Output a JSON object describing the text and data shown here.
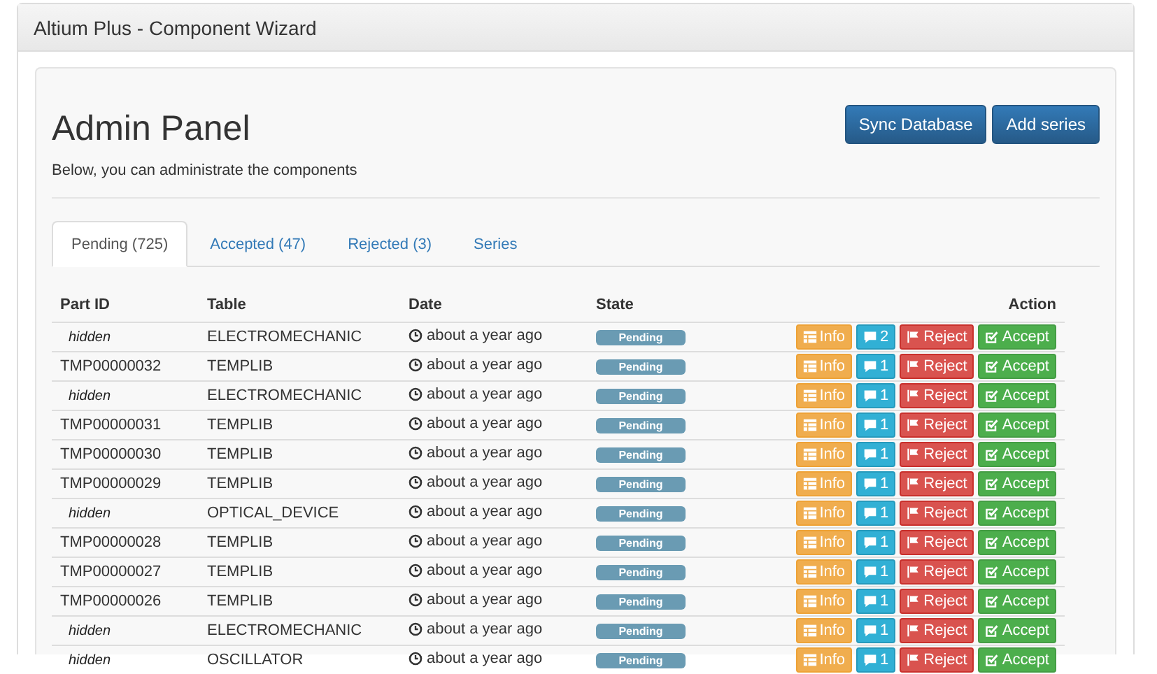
{
  "window": {
    "title": "Altium Plus - Component Wizard"
  },
  "header": {
    "title": "Admin Panel",
    "subtitle": "Below, you can administrate the components",
    "buttons": [
      "Sync Database",
      "Add series"
    ]
  },
  "tabs": [
    {
      "label": "Pending (725)",
      "selected": true
    },
    {
      "label": "Accepted (47)",
      "selected": false
    },
    {
      "label": "Rejected (3)",
      "selected": false
    },
    {
      "label": "Series",
      "selected": false
    }
  ],
  "table": {
    "columns": [
      "Part ID",
      "Table",
      "Date",
      "State",
      "Action"
    ],
    "rows": [
      {
        "part_id": "hidden",
        "hidden": true,
        "table": "ELECTROMECHANIC",
        "date": "about a year ago",
        "state": "Pending",
        "info": "Info",
        "comments": "2",
        "reject": "Reject",
        "accept": "Accept"
      },
      {
        "part_id": "TMP00000032",
        "hidden": false,
        "table": "TEMPLIB",
        "date": "about a year ago",
        "state": "Pending",
        "info": "Info",
        "comments": "1",
        "reject": "Reject",
        "accept": "Accept"
      },
      {
        "part_id": "hidden",
        "hidden": true,
        "table": "ELECTROMECHANIC",
        "date": "about a year ago",
        "state": "Pending",
        "info": "Info",
        "comments": "1",
        "reject": "Reject",
        "accept": "Accept"
      },
      {
        "part_id": "TMP00000031",
        "hidden": false,
        "table": "TEMPLIB",
        "date": "about a year ago",
        "state": "Pending",
        "info": "Info",
        "comments": "1",
        "reject": "Reject",
        "accept": "Accept"
      },
      {
        "part_id": "TMP00000030",
        "hidden": false,
        "table": "TEMPLIB",
        "date": "about a year ago",
        "state": "Pending",
        "info": "Info",
        "comments": "1",
        "reject": "Reject",
        "accept": "Accept"
      },
      {
        "part_id": "TMP00000029",
        "hidden": false,
        "table": "TEMPLIB",
        "date": "about a year ago",
        "state": "Pending",
        "info": "Info",
        "comments": "1",
        "reject": "Reject",
        "accept": "Accept"
      },
      {
        "part_id": "hidden",
        "hidden": true,
        "table": "OPTICAL_DEVICE",
        "date": "about a year ago",
        "state": "Pending",
        "info": "Info",
        "comments": "1",
        "reject": "Reject",
        "accept": "Accept"
      },
      {
        "part_id": "TMP00000028",
        "hidden": false,
        "table": "TEMPLIB",
        "date": "about a year ago",
        "state": "Pending",
        "info": "Info",
        "comments": "1",
        "reject": "Reject",
        "accept": "Accept"
      },
      {
        "part_id": "TMP00000027",
        "hidden": false,
        "table": "TEMPLIB",
        "date": "about a year ago",
        "state": "Pending",
        "info": "Info",
        "comments": "1",
        "reject": "Reject",
        "accept": "Accept"
      },
      {
        "part_id": "TMP00000026",
        "hidden": false,
        "table": "TEMPLIB",
        "date": "about a year ago",
        "state": "Pending",
        "info": "Info",
        "comments": "1",
        "reject": "Reject",
        "accept": "Accept"
      },
      {
        "part_id": "hidden",
        "hidden": true,
        "table": "ELECTROMECHANIC",
        "date": "about a year ago",
        "state": "Pending",
        "info": "Info",
        "comments": "1",
        "reject": "Reject",
        "accept": "Accept"
      },
      {
        "part_id": "hidden",
        "hidden": true,
        "table": "OSCILLATOR",
        "date": "about a year ago",
        "state": "Pending",
        "info": "Info",
        "comments": "1",
        "reject": "Reject",
        "accept": "Accept"
      }
    ]
  }
}
